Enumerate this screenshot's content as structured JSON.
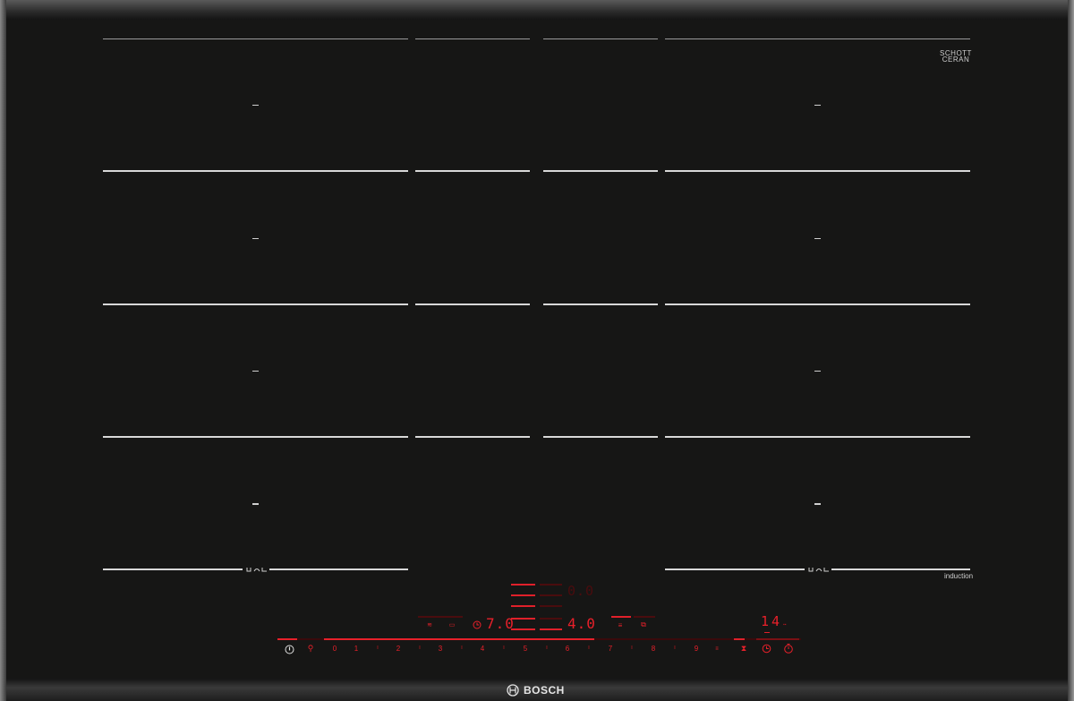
{
  "brand": {
    "name": "BOSCH",
    "glass_brand": "SCHOTT CERAN",
    "badge": "induction"
  },
  "colors": {
    "display_red": "#e8202a",
    "display_red_dim": "#4a0c0e",
    "glass": "#161615",
    "marking": "#d8d8d8"
  },
  "displays": {
    "top_center": "0.0",
    "zone_left": "7.0",
    "zone_right": "4.0",
    "timer": "14"
  },
  "slider": {
    "labels": [
      "0",
      "1",
      "2",
      "3",
      "4",
      "5",
      "6",
      "7",
      "8",
      "9"
    ],
    "level_fraction": 0.66
  },
  "icons": {
    "power": "power-icon",
    "child_lock": "child-lock-icon",
    "timer": "timer-icon",
    "stopwatch": "stopwatch-icon",
    "hourglass": "hourglass-icon",
    "flex_zone": "flex-zone-icon"
  }
}
